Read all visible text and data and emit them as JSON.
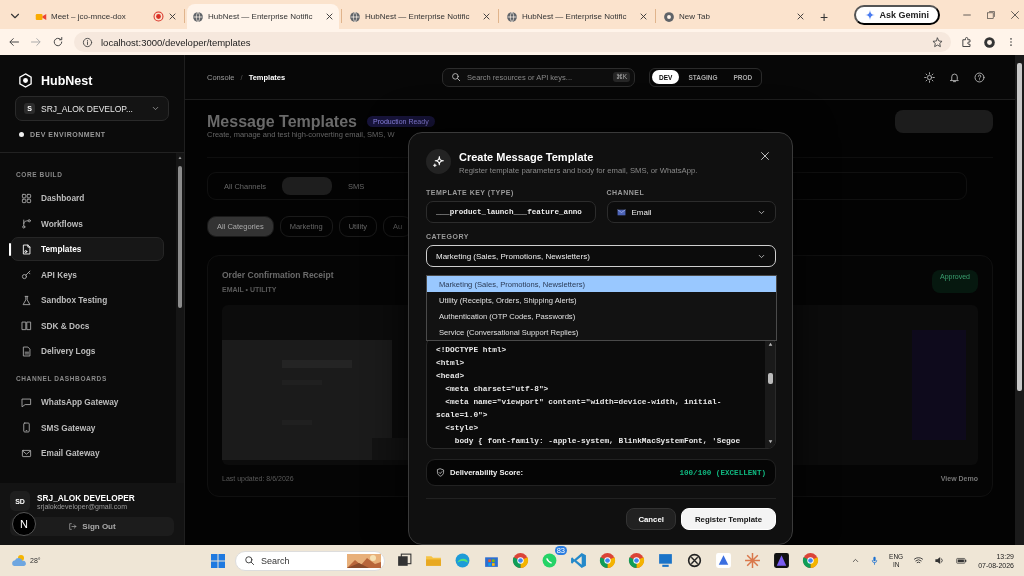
{
  "browser": {
    "tabs": [
      {
        "title": "Meet – jco-mnce-dox",
        "kind": "meet",
        "selected": false,
        "recording": true
      },
      {
        "title": "HubNest — Enterprise Notific",
        "kind": "site",
        "selected": true,
        "recording": false
      },
      {
        "title": "HubNest — Enterprise Notific",
        "kind": "site",
        "selected": false,
        "recording": false
      },
      {
        "title": "HubNest — Enterprise Notific",
        "kind": "site",
        "selected": false,
        "recording": false
      },
      {
        "title": "New Tab",
        "kind": "chrome",
        "selected": false,
        "recording": false
      }
    ],
    "new_tab": "+",
    "gemini": "Ask Gemini",
    "url": "localhost:3000/developer/templates"
  },
  "sidebar": {
    "brand": "HubNest",
    "workspace": {
      "initial": "S",
      "name": "SRJ_ALOK DEVELOP..."
    },
    "environment": "DEV ENVIRONMENT",
    "sections": [
      {
        "title": "CORE BUILD",
        "items": [
          {
            "label": "Dashboard",
            "selected": false
          },
          {
            "label": "Workflows",
            "selected": false
          },
          {
            "label": "Templates",
            "selected": true
          },
          {
            "label": "API Keys",
            "selected": false
          },
          {
            "label": "Sandbox Testing",
            "selected": false
          },
          {
            "label": "SDK & Docs",
            "selected": false
          },
          {
            "label": "Delivery Logs",
            "selected": false
          }
        ]
      },
      {
        "title": "CHANNEL DASHBOARDS",
        "items": [
          {
            "label": "WhatsApp Gateway",
            "selected": false
          },
          {
            "label": "SMS Gateway",
            "selected": false
          },
          {
            "label": "Email Gateway",
            "selected": false
          }
        ]
      }
    ],
    "user": {
      "initials": "SD",
      "name": "SRJ_ALOK DEVELOPER",
      "email": "srjalokdeveloper@gmail.com"
    },
    "sign_out": "Sign Out",
    "assistant_badge": "N"
  },
  "topbar": {
    "breadcrumb": [
      "Console",
      "Templates"
    ],
    "separator": "/",
    "search": {
      "placeholder": "Search resources or API keys...",
      "shortcut": "⌘K"
    },
    "environments": [
      {
        "label": "DEV",
        "selected": true
      },
      {
        "label": "STAGING",
        "selected": false
      },
      {
        "label": "PROD",
        "selected": false
      }
    ]
  },
  "page": {
    "title": "Message Templates",
    "badge": "Production Ready",
    "subtitle": "Create, manage and test high-converting email, SMS, W",
    "channel_filters": [
      {
        "label": "All Channels",
        "selected": false
      },
      {
        "label": "SMS",
        "selected": false
      }
    ],
    "category_filters": [
      {
        "label": "All Categories",
        "selected": true
      },
      {
        "label": "Marketing",
        "selected": false
      },
      {
        "label": "Utility",
        "selected": false
      },
      {
        "label": "Au",
        "selected": false
      }
    ],
    "card": {
      "title": "Order Confirmation Receipt",
      "meta": "EMAIL • UTILITY",
      "status": "Approved",
      "updated": "Last updated: 8/6/2026",
      "link": "View Demo"
    }
  },
  "modal": {
    "title": "Create Message Template",
    "subtitle": "Register template parameters and body for email, SMS, or WhatsApp.",
    "key_label": "TEMPLATE KEY (TYPE)",
    "key_value": "___product_launch___feature_anno",
    "channel_label": "CHANNEL",
    "channel_value": "Email",
    "category_label": "CATEGORY",
    "category_value": "Marketing (Sales, Promotions, Newsletters)",
    "category_options": [
      {
        "label": "Marketing (Sales, Promotions, Newsletters)",
        "selected": true
      },
      {
        "label": "Utility (Receipts, Orders, Shipping Alerts)",
        "selected": false
      },
      {
        "label": "Authentication (OTP Codes, Passwords)",
        "selected": false
      },
      {
        "label": "Service (Conversational Support Replies)",
        "selected": false
      }
    ],
    "code_lines": [
      "<!DOCTYPE html>",
      "<html>",
      "<head>",
      "  <meta charset=\"utf-8\">",
      "  <meta name=\"viewport\" content=\"width=device-width, initial-scale=1.0\">",
      "  <style>",
      "    body { font-family: -apple-system, BlinkMacSystemFont, 'Segoe"
    ],
    "score_label": "Deliverability Score:",
    "score_value": "100/100 (EXCELLENT)",
    "cancel": "Cancel",
    "submit": "Register Template"
  },
  "taskbar": {
    "weather": "28°",
    "search": "Search",
    "badge": "83",
    "lang": "ENG",
    "region": "IN",
    "time": "13:29",
    "date": "07-08-2026"
  }
}
